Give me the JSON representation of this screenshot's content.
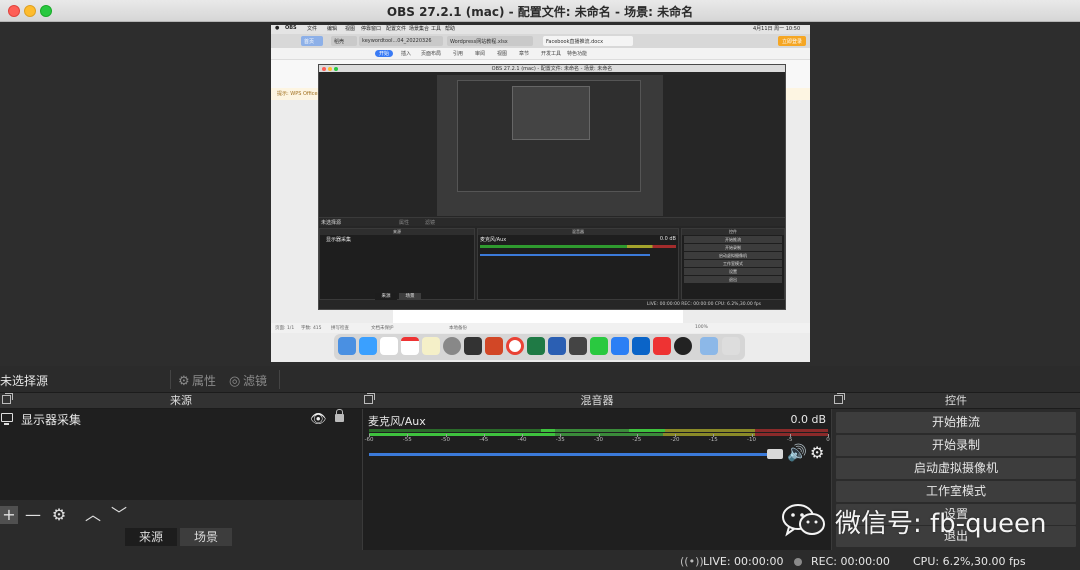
{
  "window": {
    "title": "OBS 27.2.1 (mac) - 配置文件: 未命名 - 场景: 未命名"
  },
  "preview": {
    "menubar": {
      "app": "OBS",
      "items": [
        "文件",
        "编辑",
        "视图",
        "停靠窗口",
        "配置文件",
        "场景集合",
        "工具",
        "帮助"
      ],
      "clock": "4月11日 周一 10:50"
    },
    "browser_tabs": [
      "首页",
      "稻壳",
      "keywordtool...04_20220326",
      "Wordpress网站教程.xlsx",
      "Facebook直播推流.docx"
    ],
    "login_button": "立即登录",
    "ribbon_tabs": [
      "开始",
      "插入",
      "页面布局",
      "引用",
      "审阅",
      "视图",
      "章节",
      "开发工具",
      "特色功能"
    ],
    "active_ribbon": "开始",
    "notice": "提示: WPS Office",
    "nested_obs": {
      "title": "OBS 27.2.1 (mac) - 配置文件: 未命名 - 场景: 未命名",
      "no_source": "未选择源",
      "props": "属性",
      "filters": "滤镜",
      "sources_header": "来源",
      "source_item": "显示器采集",
      "mixer_header": "混音器",
      "mixer_channel": "麦克风/Aux",
      "mixer_db": "0.0 dB",
      "controls_header": "控件",
      "controls": [
        "开始推流",
        "开始录制",
        "启动虚拟摄像机",
        "工作室模式",
        "设置",
        "退出"
      ],
      "tab_sources": "来源",
      "tab_scenes": "场景",
      "status": "LIVE: 00:00:00   REC: 00:00:00   CPU: 6.2%,30.00 fps"
    },
    "doc_status": [
      "页面: 1/1",
      "字数: 415",
      "拼写检查",
      "文档未保护",
      "本地备份",
      "100%"
    ]
  },
  "scene_bar": {
    "no_source": "未选择源",
    "properties": "属性",
    "filters": "滤镜"
  },
  "sources": {
    "header": "来源",
    "items": [
      {
        "label": "显示器采集",
        "visible": true,
        "locked": true
      }
    ],
    "tab_sources": "来源",
    "tab_scenes": "场景"
  },
  "mixer": {
    "header": "混音器",
    "channel": "麦克风/Aux",
    "db": "0.0 dB",
    "scale": [
      "-60",
      "-55",
      "-50",
      "-45",
      "-40",
      "-35",
      "-30",
      "-25",
      "-20",
      "-15",
      "-10",
      "-5",
      "0"
    ],
    "volume_level": 1.0
  },
  "controls": {
    "header": "控件",
    "start_stream": "开始推流",
    "start_record": "开始录制",
    "virtual_cam": "启动虚拟摄像机",
    "studio_mode": "工作室模式",
    "settings": "设置",
    "exit": "退出"
  },
  "status": {
    "live": "LIVE: 00:00:00",
    "rec": "REC: 00:00:00",
    "cpu": "CPU: 6.2%,30.00 fps"
  },
  "watermark": {
    "text": "微信号: fb-queen"
  },
  "colors": {
    "accent_blue": "#3b7ad9",
    "meter_green": "#3ec23e",
    "meter_yellow": "#c8c836",
    "meter_red": "#c83a3a"
  }
}
